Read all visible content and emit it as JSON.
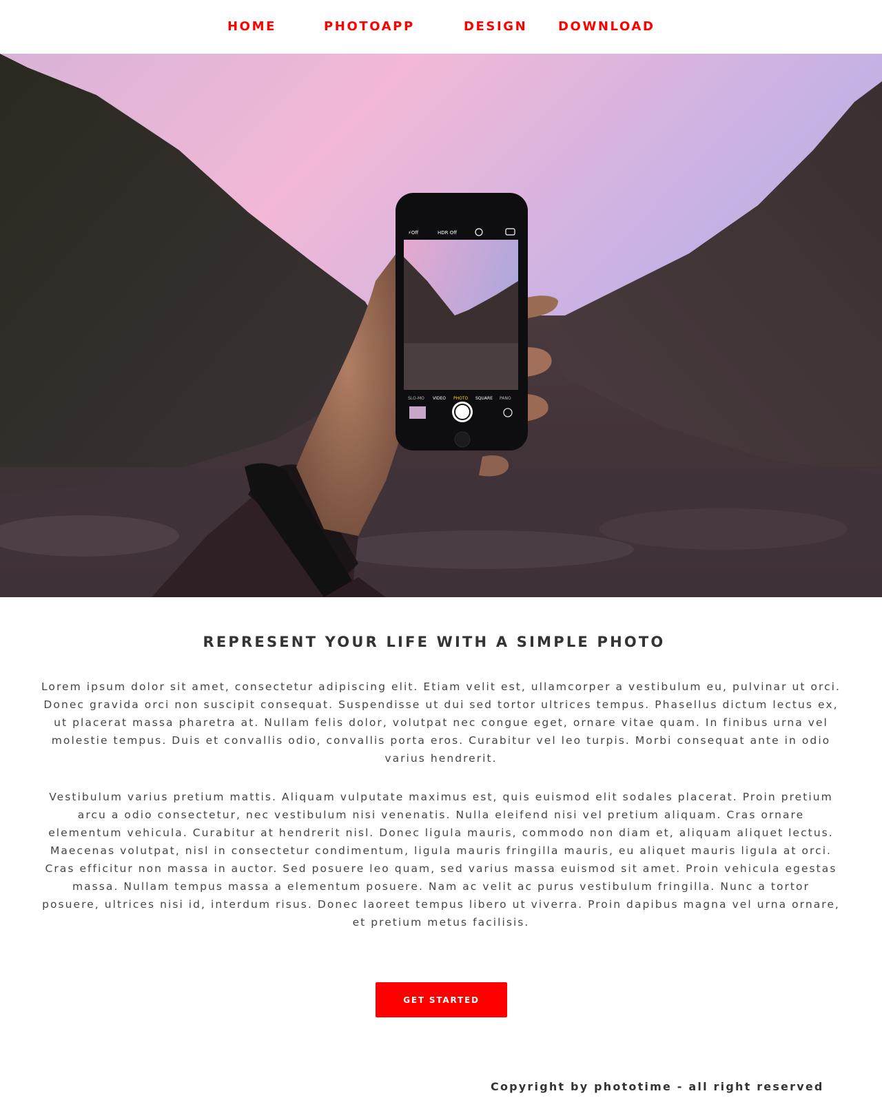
{
  "nav": {
    "items": [
      {
        "label": "HOME"
      },
      {
        "label": "PHOTOAPP"
      },
      {
        "label": "DESIGN"
      },
      {
        "label": "DOWNLOAD"
      }
    ]
  },
  "hero": {
    "phone_ui": {
      "flash": "⚡Off",
      "hdr": "HDR Off",
      "modes": [
        "SLO-MO",
        "VIDEO",
        "PHOTO",
        "SQUARE",
        "PANO"
      ]
    }
  },
  "content": {
    "headline": "REPRESENT YOUR LIFE WITH A SIMPLE PHOTO",
    "paragraph1": "Lorem ipsum dolor sit amet, consectetur adipiscing elit. Etiam velit est, ullamcorper a vestibulum eu, pulvinar ut orci. Donec gravida orci non suscipit consequat. Suspendisse ut dui sed tortor ultrices tempus. Phasellus dictum lectus ex, ut placerat massa pharetra at. Nullam felis dolor, volutpat nec congue eget, ornare vitae quam. In finibus urna vel molestie tempus. Duis et convallis odio, convallis porta eros. Curabitur vel leo turpis. Morbi consequat ante in odio varius hendrerit.",
    "paragraph2": "Vestibulum varius pretium mattis. Aliquam vulputate maximus est, quis euismod elit sodales placerat. Proin pretium arcu a odio consectetur, nec vestibulum nisi venenatis. Nulla eleifend nisi vel pretium aliquam. Cras ornare elementum vehicula. Curabitur at hendrerit nisl. Donec ligula mauris, commodo non diam et, aliquam aliquet lectus. Maecenas volutpat, nisl in consectetur condimentum, ligula mauris fringilla mauris, eu aliquet mauris ligula at orci. Cras efficitur non massa in auctor. Sed posuere leo quam, sed varius massa euismod sit amet. Proin vehicula egestas massa. Nullam tempus massa a elementum posuere. Nam ac velit ac purus vestibulum fringilla. Nunc a tortor posuere, ultrices nisi id, interdum risus. Donec laoreet tempus libero ut viverra. Proin dapibus magna vel urna ornare, et pretium metus facilisis.",
    "cta_label": "GET STARTED"
  },
  "footer": {
    "copyright": "Copyright by phototime - all right reserved"
  },
  "colors": {
    "accent": "#ff0000",
    "text": "#333333",
    "background": "#ffffff"
  }
}
